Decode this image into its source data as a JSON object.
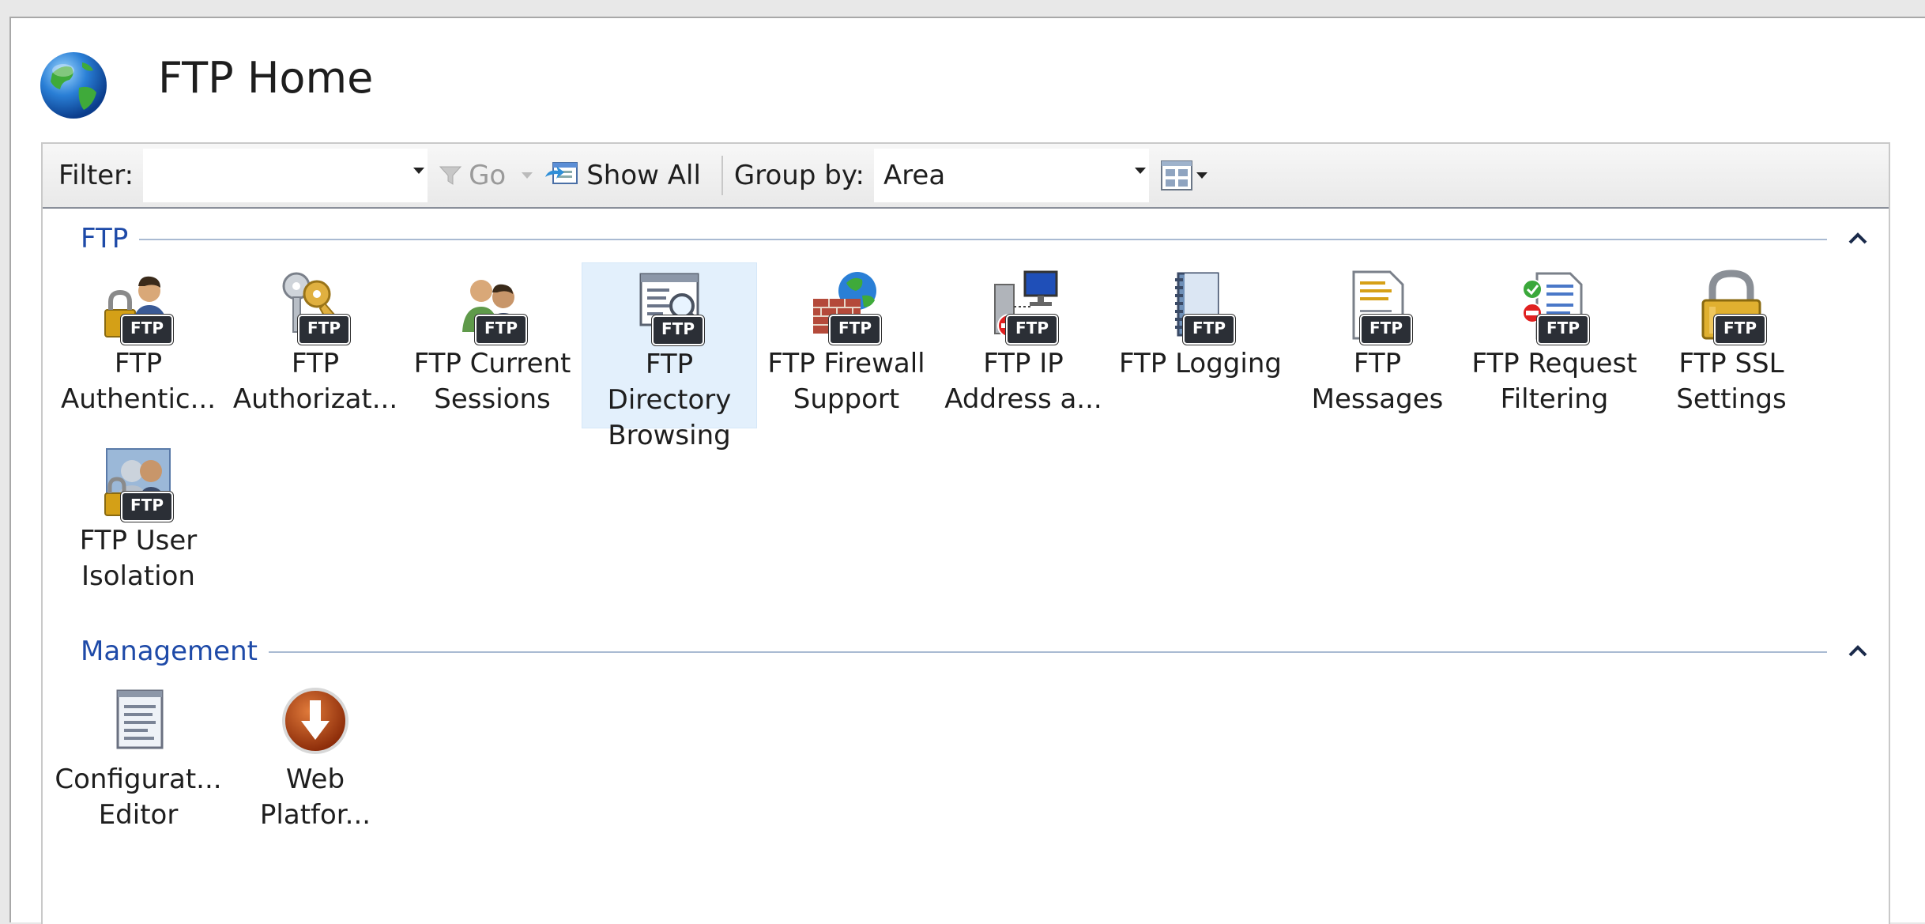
{
  "page": {
    "title": "FTP Home"
  },
  "toolbar": {
    "filter_label": "Filter:",
    "filter_value": "",
    "go_label": "Go",
    "show_all_label": "Show All",
    "group_by_label": "Group by:",
    "group_by_value": "Area"
  },
  "groups": [
    {
      "label": "FTP",
      "items": [
        {
          "label": "FTP\nAuthentic...",
          "icon": "lock-user-icon",
          "badge": "FTP"
        },
        {
          "label": "FTP\nAuthorizat...",
          "icon": "keys-icon",
          "badge": "FTP"
        },
        {
          "label": "FTP Current\nSessions",
          "icon": "users-icon",
          "badge": "FTP"
        },
        {
          "label": "FTP Directory\nBrowsing",
          "icon": "directory-browse-icon",
          "badge": "FTP"
        },
        {
          "label": "FTP Firewall\nSupport",
          "icon": "firewall-icon",
          "badge": "FTP"
        },
        {
          "label": "FTP IP\nAddress a...",
          "icon": "ip-restriction-icon",
          "badge": "FTP"
        },
        {
          "label": "FTP Logging",
          "icon": "logbook-icon",
          "badge": "FTP"
        },
        {
          "label": "FTP\nMessages",
          "icon": "message-doc-icon",
          "badge": "FTP"
        },
        {
          "label": "FTP Request\nFiltering",
          "icon": "request-filter-icon",
          "badge": "FTP"
        },
        {
          "label": "FTP SSL\nSettings",
          "icon": "padlock-icon",
          "badge": "FTP"
        },
        {
          "label": "FTP User\nIsolation",
          "icon": "user-isolation-icon",
          "badge": "FTP"
        }
      ]
    },
    {
      "label": "Management",
      "items": [
        {
          "label": "Configurat...\nEditor",
          "icon": "config-editor-icon"
        },
        {
          "label": "Web\nPlatfor...",
          "icon": "download-icon"
        }
      ]
    }
  ],
  "colors": {
    "group_label": "#1e4aa8",
    "selected_bg": "#e3f0fc",
    "group_line": "#a9bad2"
  },
  "selected_item": "FTP Directory\nBrowsing"
}
